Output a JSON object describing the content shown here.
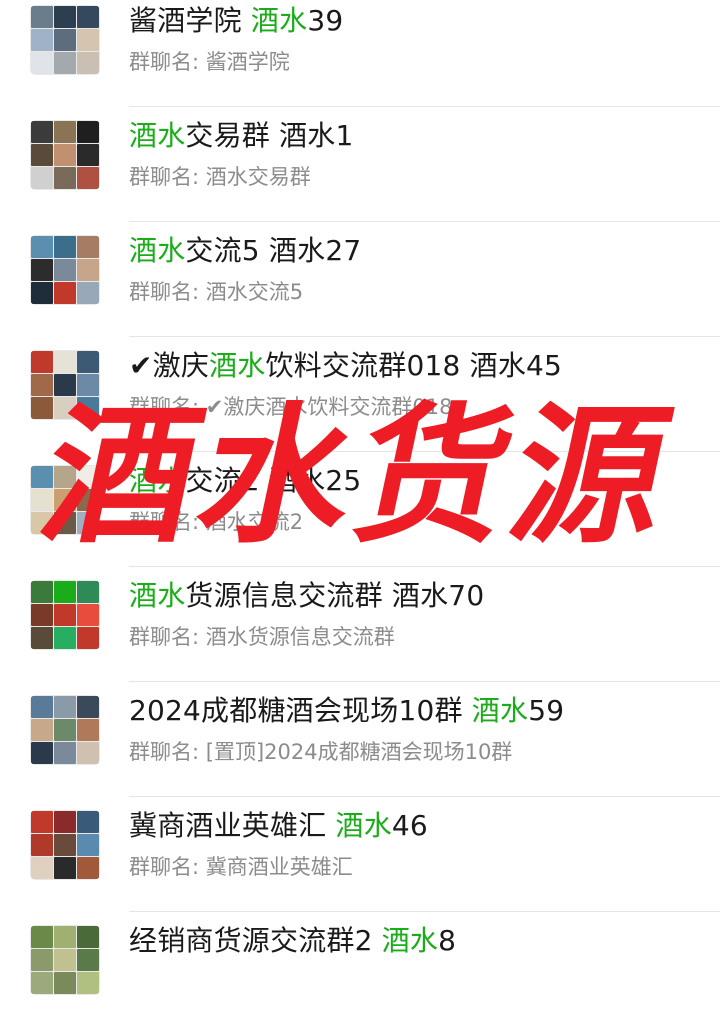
{
  "rows": [
    {
      "title_parts": [
        {
          "t": "酱酒学院 "
        },
        {
          "t": "酒水",
          "hl": true
        },
        {
          "t": "39"
        }
      ],
      "subtitle": "群聊名: 酱酒学院",
      "avatar_colors": [
        "#6b7c8a",
        "#2c3e50",
        "#34495e",
        "#9fb3c8",
        "#5d6d7e",
        "#d5c4b0",
        "#e0e4e8",
        "#a3a9ad",
        "#c9bfb3"
      ]
    },
    {
      "title_parts": [
        {
          "t": "酒水",
          "hl": true
        },
        {
          "t": "交易群 酒水1"
        }
      ],
      "subtitle": "群聊名: 酒水交易群",
      "avatar_colors": [
        "#3b3b3b",
        "#8b7355",
        "#1f1f1f",
        "#5a4a3a",
        "#c09070",
        "#2a2a2a",
        "#d0d0d0",
        "#7a6a5a",
        "#b05040"
      ]
    },
    {
      "title_parts": [
        {
          "t": "酒水",
          "hl": true
        },
        {
          "t": "交流5 酒水27"
        }
      ],
      "subtitle": "群聊名: 酒水交流5",
      "avatar_colors": [
        "#5b8fb0",
        "#3c6e8c",
        "#a57c64",
        "#2c2c2c",
        "#7a8a9a",
        "#c7a58a",
        "#1f2d3a",
        "#c0392b",
        "#98a8b8"
      ]
    },
    {
      "title_parts": [
        {
          "t": "✔激庆"
        },
        {
          "t": "酒水",
          "hl": true
        },
        {
          "t": "饮料交流群018 酒水45"
        }
      ],
      "subtitle": "群聊名: ✔激庆酒水饮料交流群018",
      "avatar_colors": [
        "#c0392b",
        "#e7e2d8",
        "#3d5a75",
        "#a06a4a",
        "#2a3a4a",
        "#6c8aa5",
        "#8a5a3a",
        "#d8cfc0",
        "#4a7a9a"
      ]
    },
    {
      "title_parts": [
        {
          "t": "酒水",
          "hl": true
        },
        {
          "t": "交流2 酒水25"
        }
      ],
      "subtitle": "群聊名: 酒水交流2",
      "avatar_colors": [
        "#5b8fb0",
        "#b5a58a",
        "#f0ede6",
        "#e6e0d0",
        "#caa070",
        "#8a6a4a",
        "#d8c8a8",
        "#6a5a4a",
        "#a0b0c0"
      ]
    },
    {
      "title_parts": [
        {
          "t": "酒水",
          "hl": true
        },
        {
          "t": "货源信息交流群  酒水70"
        }
      ],
      "subtitle": "群聊名: 酒水货源信息交流群",
      "avatar_colors": [
        "#3a7a3a",
        "#1aad19",
        "#2e8b57",
        "#7a3a2a",
        "#c0392b",
        "#e74c3c",
        "#5a4a3a",
        "#27ae60",
        "#c0392b"
      ]
    },
    {
      "title_parts": [
        {
          "t": "2024成都糖酒会现场10群  "
        },
        {
          "t": "酒水",
          "hl": true
        },
        {
          "t": "59"
        }
      ],
      "subtitle": "群聊名: [置顶]2024成都糖酒会现场10群",
      "avatar_colors": [
        "#5a7a9a",
        "#8a9aa8",
        "#3a4a5a",
        "#c8a88a",
        "#6a8a6a",
        "#b07a5a",
        "#2a3a4a",
        "#7a8a9a",
        "#d0c0b0"
      ]
    },
    {
      "title_parts": [
        {
          "t": "冀商酒业英雄汇 "
        },
        {
          "t": "酒水",
          "hl": true
        },
        {
          "t": "46"
        }
      ],
      "subtitle": "群聊名: 冀商酒业英雄汇",
      "avatar_colors": [
        "#c0392b",
        "#8a2a2a",
        "#3a5a7a",
        "#b03a2a",
        "#6a4a3a",
        "#5a8ab0",
        "#e0d0c0",
        "#2a2a2a",
        "#a05a3a"
      ]
    },
    {
      "title_parts": [
        {
          "t": "经销商货源交流群2  "
        },
        {
          "t": "酒水",
          "hl": true
        },
        {
          "t": "8"
        }
      ],
      "subtitle": "",
      "avatar_colors": [
        "#6a8a4a",
        "#a0b070",
        "#4a6a3a",
        "#8a9a6a",
        "#c0c090",
        "#5a7a4a",
        "#9aaa7a",
        "#7a8a5a",
        "#b0c080"
      ]
    }
  ],
  "overlay_text": "酒水货源",
  "overlay_color": "#ee1c25"
}
